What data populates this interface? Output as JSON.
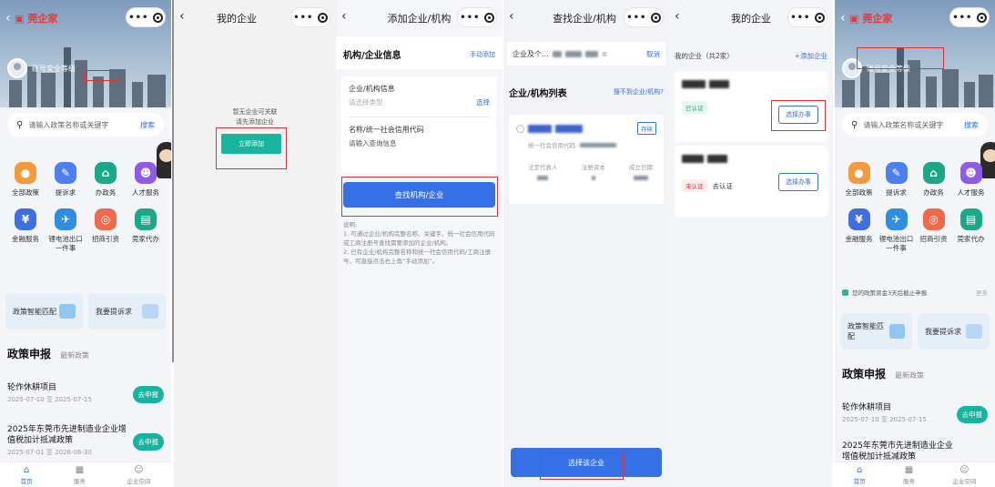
{
  "home": {
    "brand": "莞企家",
    "user": "账号安全等级",
    "search_placeholder": "请输入政策名称或关键字",
    "search_btn": "搜索",
    "services": [
      "全部政策",
      "提诉求",
      "办政务",
      "人才服务",
      "金融服务",
      "锂电池出口一件事",
      "招商引资",
      "莞家代办"
    ],
    "card_left": "政策智能匹配",
    "card_right": "我要提诉求",
    "section": "政策申报",
    "section_sub": "最新政策",
    "policies": [
      {
        "title": "轮作休耕项目",
        "date": "2025-07-10 至 2025-07-15",
        "action": "去申报"
      },
      {
        "title": "2025年东莞市先进制造业企业增值税加计抵减政策",
        "date": "2025-07-01 至 2026-06-30",
        "action": "去申报"
      }
    ],
    "notice": "您的政策资金3天后截止申报",
    "notice_more": "更多",
    "tabs": [
      "首页",
      "服务",
      "企业空间"
    ]
  },
  "my_enterprise_empty": {
    "title": "我的企业",
    "empty_line1": "暂无企业可关联",
    "empty_line2": "请先添加企业",
    "add_btn": "立即添加"
  },
  "add_enterprise": {
    "title": "添加企业/机构",
    "section": "机构/企业信息",
    "manual_add": "手动添加",
    "field1_label": "企业/机构信息",
    "field1_placeholder": "请选择类型",
    "field1_action": "选择",
    "field2_label": "名称/统一社会信用代码",
    "field2_placeholder": "请输入查询信息",
    "find_btn": "查找机构/企业",
    "notes_title": "说明:",
    "note1": "1. 可通过企业/机构完整名称、关键字、统一社会信用代码或工商注册号查找需要添加的企业/机构。",
    "note2": "2. 已有企业/机构完整名称和统一社会信用代码/工商注册号，可直接点击右上角“手动添加”。"
  },
  "find_enterprise": {
    "title": "查找企业/机构",
    "search_prefix": "企业及个...",
    "cancel": "取消",
    "list_title": "企业/机构列表",
    "not_found": "搜不到企业/机构?",
    "badge": "存续",
    "credit_label": "统一社会信用代码:",
    "col1": "法定代表人",
    "col2": "注册资本",
    "col3": "成立日期",
    "choose_btn": "选择该企业"
  },
  "my_enterprise_list": {
    "title": "我的企业",
    "count": "我的企业（共2家）",
    "add": "+添加企业",
    "tag_verified": "已认证",
    "tag_unverified": "未认证",
    "go_auth": "去认证",
    "handle_btn": "选择办事"
  }
}
